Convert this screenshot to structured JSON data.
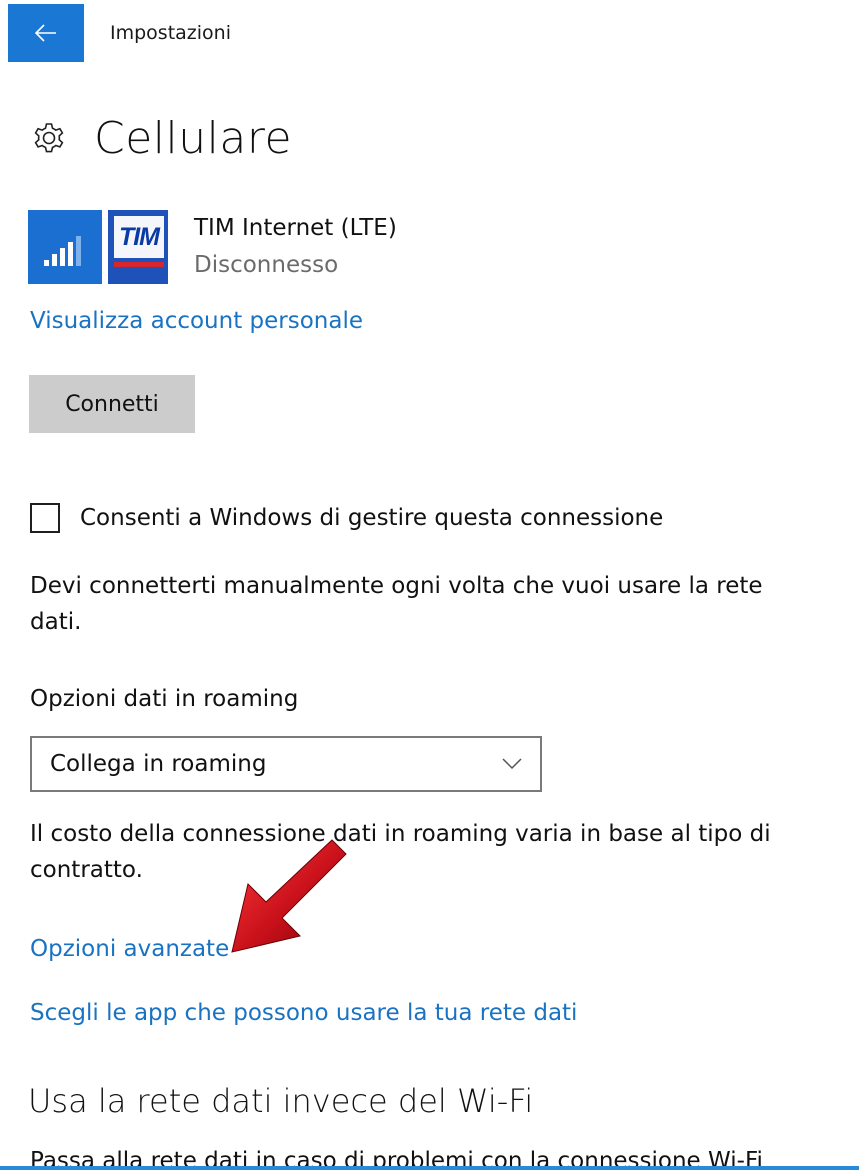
{
  "titlebar": {
    "title": "Impostazioni",
    "back_icon": "arrow-left-icon",
    "accent_color": "#1a78d4"
  },
  "page": {
    "icon": "gear-icon",
    "title": "Cellulare"
  },
  "connection": {
    "signal_icon": "signal-bars-icon",
    "operator_logo_text": "TIM",
    "name": "TIM Internet (LTE)",
    "status": "Disconnesso",
    "account_link": "Visualizza account personale",
    "connect_button": "Connetti"
  },
  "manage": {
    "checked": false,
    "label": "Consenti a Windows di gestire questa connessione",
    "description": "Devi connetterti manualmente ogni volta che vuoi usare la rete dati."
  },
  "roaming": {
    "label": "Opzioni dati in roaming",
    "selected": "Collega in roaming",
    "description": "Il costo della connessione dati in roaming varia in base al tipo di contratto."
  },
  "links": {
    "advanced": "Opzioni avanzate",
    "choose_apps": "Scegli le app che possono usare la tua rete dati"
  },
  "wifi_section": {
    "title": "Usa la rete dati invece del Wi-Fi",
    "description": "Passa alla rete dati in caso di problemi con la connessione Wi-Fi"
  },
  "colors": {
    "link": "#1a73c2",
    "annotation_arrow": "#c8101a"
  }
}
